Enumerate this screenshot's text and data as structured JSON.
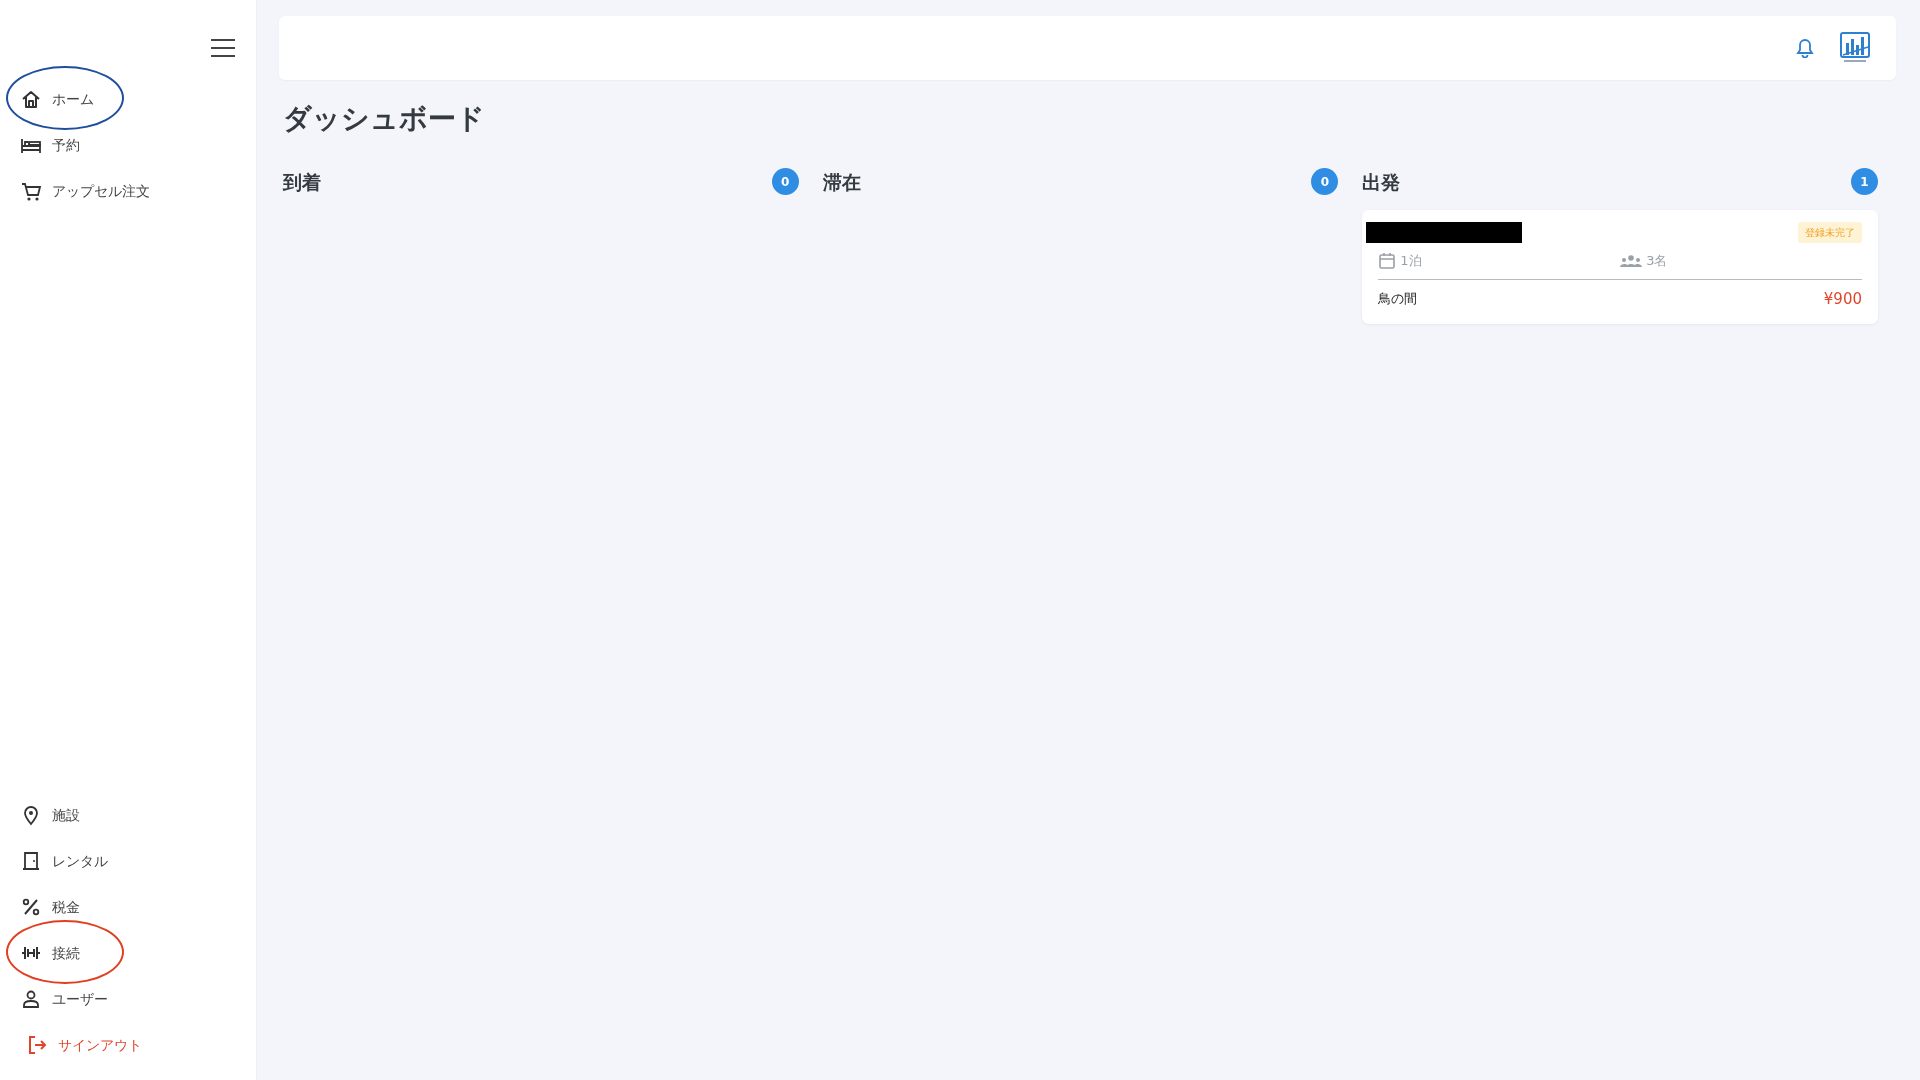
{
  "sidebar": {
    "top_items": [
      {
        "label": "ホーム",
        "color": "#1f4ea0"
      },
      {
        "label": "予約"
      },
      {
        "label": "アップセル注文"
      }
    ],
    "bottom_items": [
      {
        "label": "施設"
      },
      {
        "label": "レンタル"
      },
      {
        "label": "税金"
      },
      {
        "label": "接続",
        "color": "#e0401f"
      },
      {
        "label": "ユーザー"
      }
    ],
    "sign_out": {
      "label": "サインアウト"
    }
  },
  "page_title": "ダッシュボード",
  "columns": [
    {
      "title": "到着",
      "count": "0"
    },
    {
      "title": "滞在",
      "count": "0"
    },
    {
      "title": "出発",
      "count": "1",
      "cards": [
        {
          "name_redacted": true,
          "status": "登録未完了",
          "nights": "1泊",
          "guests": "3名",
          "room": "鳥の間",
          "price": "¥900"
        }
      ]
    }
  ]
}
